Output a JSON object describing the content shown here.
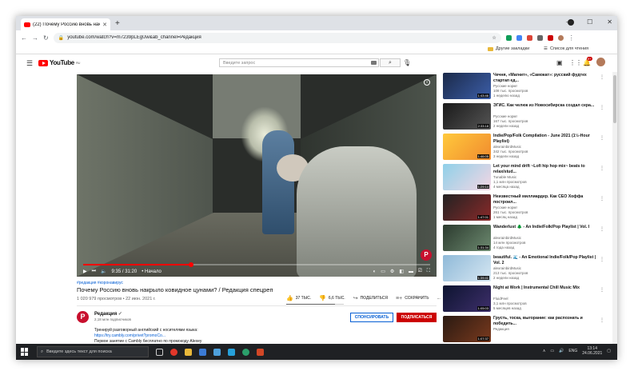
{
  "browser": {
    "tab_title": "(22) Почему Россию вновь накрыл",
    "url": "youtube.com/watch?v=m7239pLEgUw&ab_channel=Редакция",
    "bookmark_other": "Другие закладки",
    "bookmark_reading": "Список для чтения"
  },
  "youtube": {
    "logo_text": "YouTube",
    "logo_region": "RU",
    "search_placeholder": "Введите запрос",
    "notification_count": "9+"
  },
  "player": {
    "time": "9:35 / 31:20",
    "chapter": "• Начало",
    "progress": 0.31,
    "brand_letter": "Р"
  },
  "video": {
    "tags": "#редакция #коронавирус",
    "title": "Почему Россию вновь накрыло ковидное цунами? / Редакция спецреп",
    "views_date": "1 020 979 просмотров • 22 июн. 2021 г.",
    "likes": "37 ТЫС.",
    "dislikes": "6,6 ТЫС.",
    "like_ratio": 0.85,
    "share": "ПОДЕЛИТЬСЯ",
    "save": "СОХРАНИТЬ",
    "more": "..."
  },
  "channel": {
    "name": "Редакция",
    "subs": "2,18 млн подписчиков",
    "sponsor": "СПОНСИРОВАТЬ",
    "subscribe": "ПОДПИСАТЬСЯ",
    "avatar_letter": "Р",
    "desc_line1": "Тренируй разговорный английский с носителями языка:",
    "desc_line2": "https://try.cambly.com/privet?promoCo...",
    "desc_line3": "Первое занятие с Cambly бесплатно по промокоду Alexey"
  },
  "related": [
    {
      "title": "Чечня, «Магнит», «Самокат»: русский фудтех стартап ед...",
      "channel": "Русские норм!",
      "views": "108 тыс. просмотров",
      "date": "1 неделю назад",
      "duration": "1:43:46",
      "colors": [
        "#1b2a4a",
        "#3c5ea8"
      ]
    },
    {
      "title": "ЭГИС. Как челюк из Новосибирска создал сера...",
      "channel": "Русские норм!",
      "views": "167 тыс. просмотров",
      "date": "2 недели назад",
      "duration": "2:33:18",
      "colors": [
        "#1a1a1a",
        "#555555"
      ]
    },
    {
      "title": "Indie/Pop/Folk Compilation - June 2021 (1½-Hour Playlist)",
      "channel": "alexrainbirdMusic",
      "views": "342 тыс. просмотров",
      "date": "3 недели назад",
      "duration": "1:46:05",
      "colors": [
        "#ffc93c",
        "#f18b2e"
      ]
    },
    {
      "title": "Let your mind drift ~Lofi hip hop mix~ beats to relax/stud...",
      "channel": "Tunable Music",
      "views": "1,1 млн просмотров",
      "date": "4 месяца назад",
      "duration": "1:29:14",
      "colors": [
        "#8fd0e8",
        "#f4d6e4"
      ]
    },
    {
      "title": "Неизвестный миллиардер. Как CEO Хоффа построил...",
      "channel": "Русские норм!",
      "views": "261 тыс. просмотров",
      "date": "1 месяц назад",
      "duration": "1:47:01",
      "colors": [
        "#222222",
        "#8a2a2a"
      ]
    },
    {
      "title": "Wanderlust 🌲 - An Indie/Folk/Pop Playlist | Vol. I",
      "channel": "alexrainbirdMusic",
      "views": "14 млн просмотров",
      "date": "4 года назад",
      "duration": "1:31:34",
      "colors": [
        "#2b3a2e",
        "#6d8a70"
      ]
    },
    {
      "title": "beautiful. 🌊 - An Emotional Indie/Folk/Pop Playlist | Vol. 2",
      "channel": "alexrainbirdMusic",
      "views": "213 тыс. просмотров",
      "date": "2 недели назад",
      "duration": "1:39:41",
      "colors": [
        "#8fb9d8",
        "#d6e7f2"
      ]
    },
    {
      "title": "Night at Work | Instrumental Chill Music Mix",
      "channel": "FluidFeel",
      "views": "3,1 млн просмотров",
      "date": "5 месяцев назад",
      "duration": "1:05:03",
      "colors": [
        "#0d1430",
        "#3e2f6b"
      ]
    },
    {
      "title": "Грусть, тоска, выгорание: как распознать и победить...",
      "channel": "Редакция",
      "views": "",
      "date": "",
      "duration": "1:07:37",
      "colors": [
        "#2a1a12",
        "#7a3a1e"
      ]
    }
  ],
  "taskbar": {
    "search_placeholder": "Введите здесь текст для поиска",
    "lang": "ENG",
    "time": "13:14",
    "date": "24.06.2021"
  }
}
